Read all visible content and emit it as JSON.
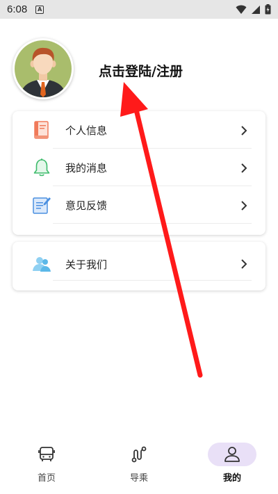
{
  "status_bar": {
    "time": "6:08",
    "notification_icon": "A",
    "icons": [
      "wifi-icon",
      "signal-icon",
      "battery-icon"
    ]
  },
  "profile": {
    "avatar_icon": "avatar-businessman",
    "login_text": "点击登陆/注册"
  },
  "menu_group_1": [
    {
      "label": "个人信息",
      "icon": "book-icon",
      "color": "#f07a5a"
    },
    {
      "label": "我的消息",
      "icon": "bell-icon",
      "color": "#3dbb6b"
    },
    {
      "label": "意见反馈",
      "icon": "feedback-icon",
      "color": "#4a8fe0"
    }
  ],
  "menu_group_2": [
    {
      "label": "关于我们",
      "icon": "users-icon",
      "color": "#5bb8e8"
    }
  ],
  "tab_bar": {
    "tabs": [
      {
        "label": "首页",
        "icon": "bus-icon",
        "active": false
      },
      {
        "label": "导乘",
        "icon": "route-icon",
        "active": false
      },
      {
        "label": "我的",
        "icon": "person-icon",
        "active": true
      }
    ],
    "active_color": "#e9e0f7"
  },
  "annotation": {
    "arrow_color": "#ff1a1a"
  }
}
